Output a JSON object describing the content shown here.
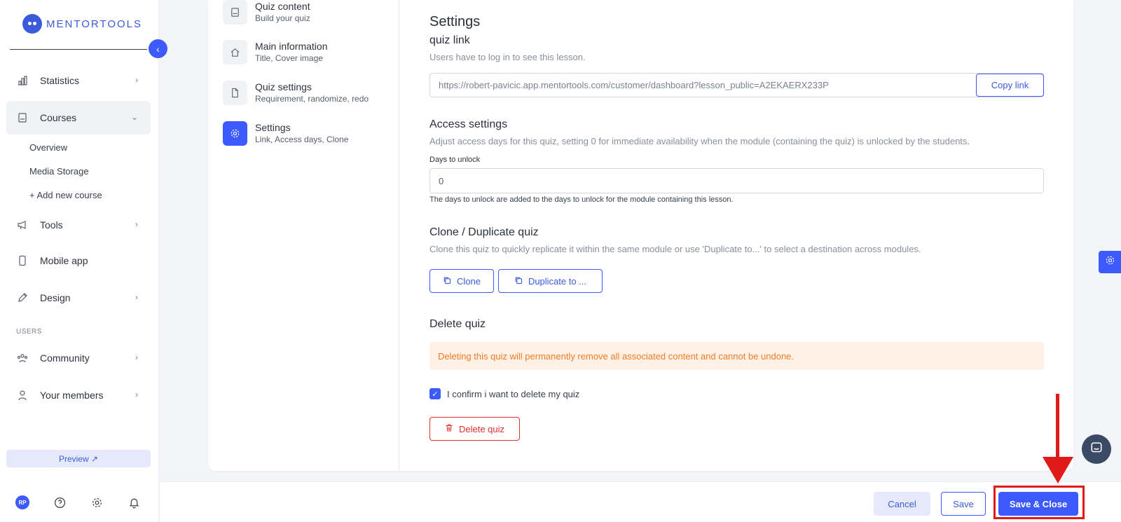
{
  "brand": {
    "name": "MENTORTOOLS"
  },
  "sidebar": {
    "items": [
      {
        "label": "Statistics",
        "icon": "bar-chart-icon"
      },
      {
        "label": "Courses",
        "icon": "book-icon"
      },
      {
        "label": "Tools",
        "icon": "megaphone-icon"
      },
      {
        "label": "Mobile app",
        "icon": "phone-icon"
      },
      {
        "label": "Design",
        "icon": "pencil-icon"
      },
      {
        "label": "Community",
        "icon": "people-icon"
      },
      {
        "label": "Your members",
        "icon": "user-icon"
      }
    ],
    "courses_sub": [
      "Overview",
      "Media Storage",
      "+ Add new course"
    ],
    "section_users": "USERS",
    "preview": "Preview ↗",
    "avatar_initials": "RP"
  },
  "steps": [
    {
      "title": "Quiz content",
      "sub": "Build your quiz"
    },
    {
      "title": "Main information",
      "sub": "Title, Cover image"
    },
    {
      "title": "Quiz settings",
      "sub": "Requirement, randomize, redo"
    },
    {
      "title": "Settings",
      "sub": "Link, Access days, Clone"
    }
  ],
  "settings": {
    "title": "Settings",
    "link_heading": "quiz link",
    "link_desc": "Users have to log in to see this lesson.",
    "link_url": "https://robert-pavicic.app.mentortools.com/customer/dashboard?lesson_public=A2EKAERX233P",
    "copy_label": "Copy link",
    "access_heading": "Access settings",
    "access_desc": "Adjust access days for this quiz, setting 0 for immediate availability when the module (containing the quiz) is unlocked by the students.",
    "days_label": "Days to unlock",
    "days_value": "0",
    "days_hint": "The days to unlock are added to the days to unlock for the module containing this lesson.",
    "clone_heading": "Clone / Duplicate quiz",
    "clone_desc": "Clone this quiz to quickly replicate it within the same module or use 'Duplicate to...' to select a destination across modules.",
    "clone_label": "Clone",
    "duplicate_label": "Duplicate to ...",
    "delete_heading": "Delete quiz",
    "delete_warning": "Deleting this quiz will permanently remove all associated content and cannot be undone.",
    "confirm_label": "I confirm i want to delete my quiz",
    "confirm_checked": true,
    "delete_label": "Delete quiz"
  },
  "footer": {
    "cancel": "Cancel",
    "save": "Save",
    "save_close": "Save & Close"
  },
  "colors": {
    "accent": "#3d5afe",
    "warning": "#f07b26",
    "danger": "#e03131",
    "annotation": "#e01919"
  }
}
